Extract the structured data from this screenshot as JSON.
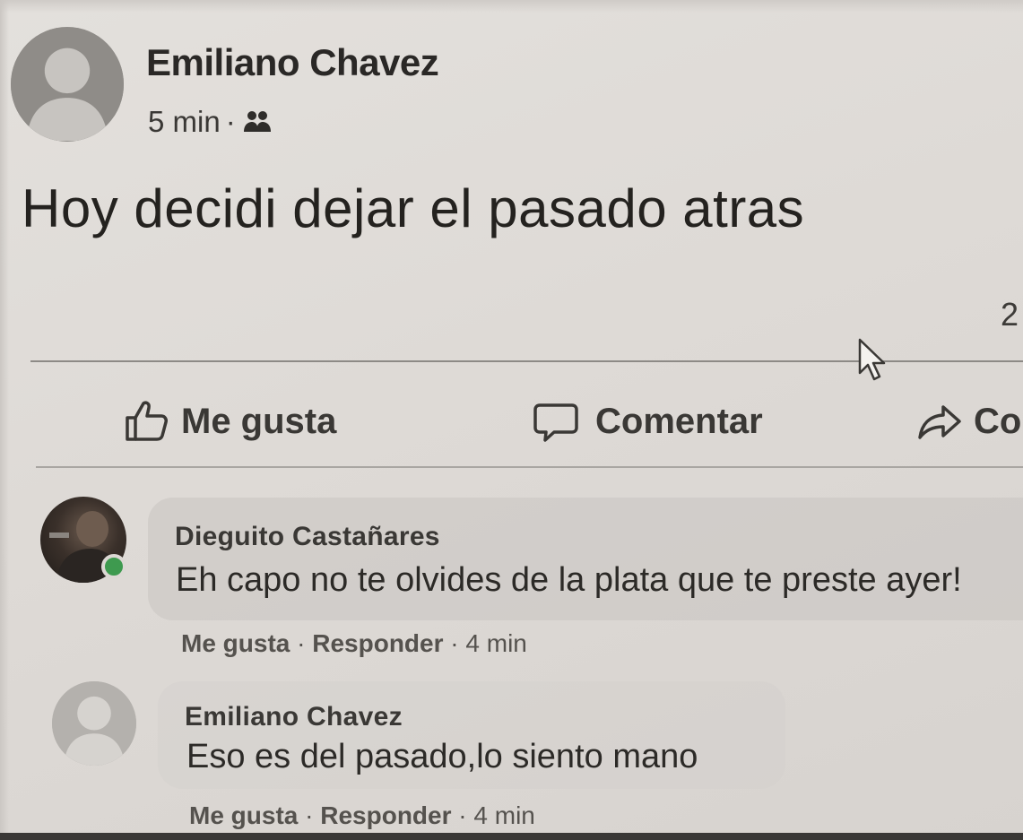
{
  "post": {
    "author": "Emiliano Chavez",
    "time": "5 min",
    "audience_icon": "friends-icon",
    "text": "Hoy decidi dejar el pasado atras",
    "reaction_count": "2"
  },
  "actions": {
    "like_label": "Me gusta",
    "comment_label": "Comentar",
    "share_label": "Co"
  },
  "comments": [
    {
      "author": "Dieguito Castañares",
      "text": "Eh capo no te olvides de la plata que te preste ayer!",
      "like_label": "Me gusta",
      "reply_label": "Responder",
      "time": "4 min",
      "online": true
    },
    {
      "author": "Emiliano Chavez",
      "text": "Eso es del pasado,lo siento mano",
      "like_label": "Me gusta",
      "reply_label": "Responder",
      "time": "4 min",
      "online": false
    }
  ],
  "colors": {
    "background": "#dedad6",
    "text": "#2a2826",
    "online": "#3e9a4f"
  }
}
